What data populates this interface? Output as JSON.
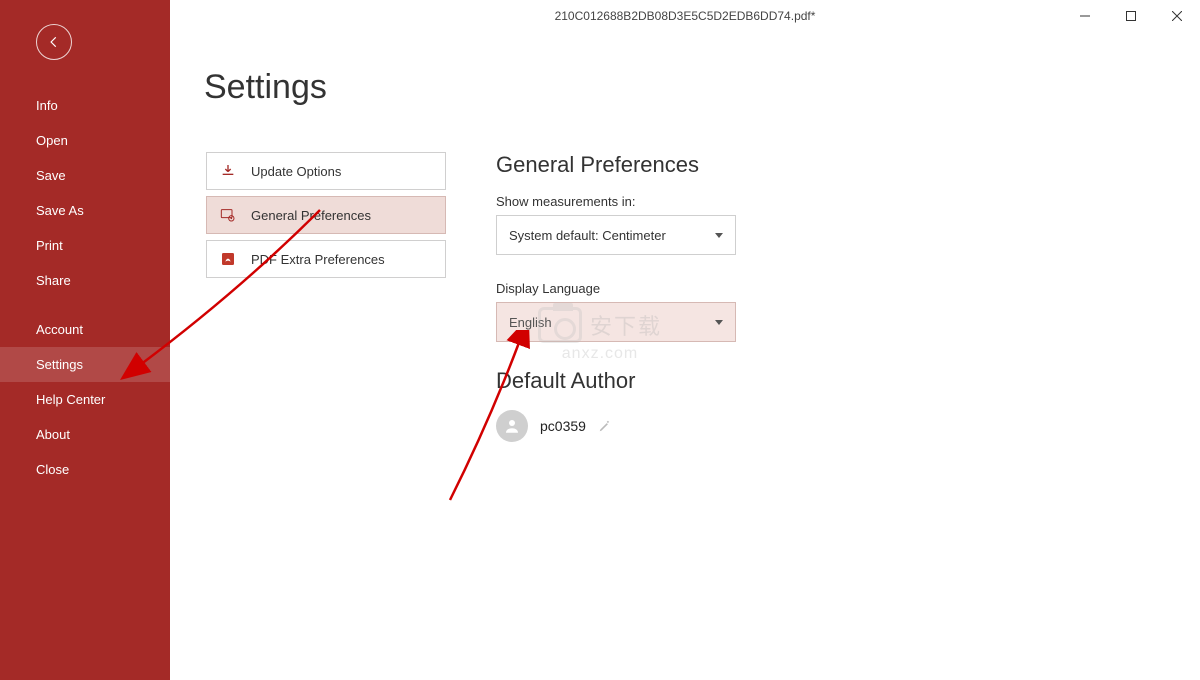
{
  "titlebar": {
    "title": "210C012688B2DB08D3E5C5D2EDB6DD74.pdf*"
  },
  "sidebar": {
    "items": [
      {
        "label": "Info"
      },
      {
        "label": "Open"
      },
      {
        "label": "Save"
      },
      {
        "label": "Save As"
      },
      {
        "label": "Print"
      },
      {
        "label": "Share"
      }
    ],
    "items2": [
      {
        "label": "Account"
      },
      {
        "label": "Settings"
      },
      {
        "label": "Help Center"
      },
      {
        "label": "About"
      },
      {
        "label": "Close"
      }
    ],
    "active": "Settings"
  },
  "page": {
    "heading": "Settings"
  },
  "options": {
    "update": "Update Options",
    "general": "General Preferences",
    "pdf": "PDF Extra Preferences"
  },
  "prefs": {
    "section_title": "General Preferences",
    "measurements_label": "Show measurements in:",
    "measurements_value": "System default: Centimeter",
    "language_label": "Display Language",
    "language_value": "English",
    "author_title": "Default Author",
    "author_name": "pc0359"
  },
  "watermark": {
    "text": "安下载",
    "url": "anxz.com"
  },
  "colors": {
    "brand": "#a42a27",
    "accent_bg": "#efdcd8"
  }
}
